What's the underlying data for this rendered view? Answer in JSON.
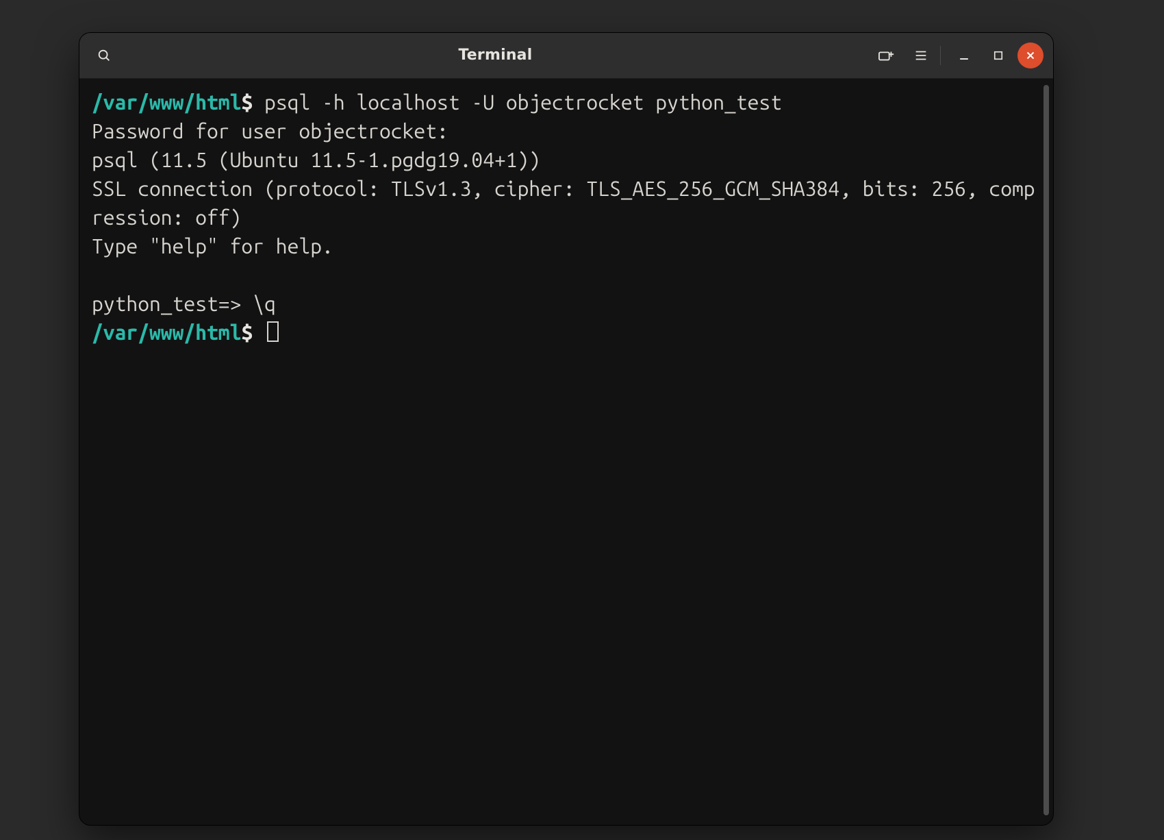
{
  "window": {
    "title": "Terminal"
  },
  "colors": {
    "prompt_path": "#2bb9a9",
    "background": "#121212",
    "foreground": "#d7d4cf",
    "close_button": "#de4d2c"
  },
  "terminal": {
    "lines": [
      {
        "type": "shell",
        "path": "/var/www/html",
        "punct": "$ ",
        "command": "psql -h localhost -U objectrocket python_test"
      },
      {
        "type": "plain",
        "text": "Password for user objectrocket:"
      },
      {
        "type": "plain",
        "text": "psql (11.5 (Ubuntu 11.5-1.pgdg19.04+1))"
      },
      {
        "type": "plain",
        "text": "SSL connection (protocol: TLSv1.3, cipher: TLS_AES_256_GCM_SHA384, bits: 256, compression: off)"
      },
      {
        "type": "plain",
        "text": "Type \"help\" for help."
      },
      {
        "type": "blank"
      },
      {
        "type": "psql",
        "prompt": "python_test=> ",
        "command": "\\q"
      },
      {
        "type": "shell-cursor",
        "path": "/var/www/html",
        "punct": "$ "
      }
    ]
  }
}
